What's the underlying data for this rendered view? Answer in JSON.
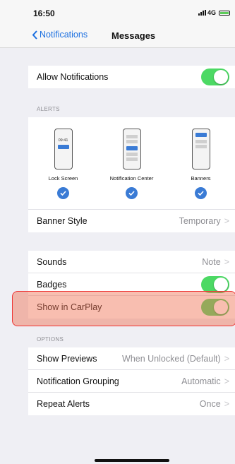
{
  "status": {
    "time": "16:50",
    "network": "4G"
  },
  "nav": {
    "back_label": "Notifications",
    "title": "Messages"
  },
  "allow": {
    "label": "Allow Notifications",
    "on": true
  },
  "alerts": {
    "header": "ALERTS",
    "options": [
      {
        "label": "Lock Screen",
        "phone_time": "09:41",
        "checked": true
      },
      {
        "label": "Notification Center",
        "checked": true
      },
      {
        "label": "Banners",
        "checked": true
      }
    ]
  },
  "banner_style": {
    "label": "Banner Style",
    "value": "Temporary"
  },
  "sounds": {
    "label": "Sounds",
    "value": "Note"
  },
  "badges": {
    "label": "Badges",
    "on": true
  },
  "carplay": {
    "label": "Show in CarPlay",
    "on": true
  },
  "options": {
    "header": "OPTIONS",
    "show_previews": {
      "label": "Show Previews",
      "value": "When Unlocked (Default)"
    },
    "grouping": {
      "label": "Notification Grouping",
      "value": "Automatic"
    },
    "repeat": {
      "label": "Repeat Alerts",
      "value": "Once"
    }
  },
  "colors": {
    "accent": "#1b6fe0",
    "toggle_on": "#4cd964",
    "highlight": "#e33"
  }
}
